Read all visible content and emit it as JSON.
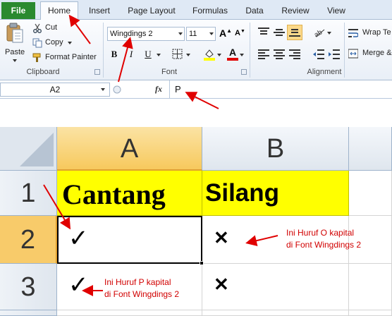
{
  "tabs": {
    "file": "File",
    "items": [
      "Home",
      "Insert",
      "Page Layout",
      "Formulas",
      "Data",
      "Review",
      "View"
    ]
  },
  "clipboard": {
    "paste": "Paste",
    "cut": "Cut",
    "copy": "Copy",
    "format_painter": "Format Painter",
    "label": "Clipboard"
  },
  "font": {
    "name": "Wingdings 2",
    "size": "11",
    "grow": "A",
    "shrink": "A",
    "bold": "B",
    "italic": "I",
    "underline": "U",
    "font_color_glyph": "A",
    "label": "Font"
  },
  "alignment": {
    "wrap_text": "Wrap Te",
    "merge": "Merge &",
    "label": "Alignment"
  },
  "formula_bar": {
    "name_box": "A2",
    "fx": "fx",
    "content": "P"
  },
  "grid": {
    "columns": [
      "A",
      "B"
    ],
    "rows": [
      "1",
      "2",
      "3"
    ],
    "a1": "Cantang",
    "b1": "Silang",
    "a2_mark": "✓",
    "b2_mark": "✕",
    "a3_mark": "✓",
    "b3_mark": "✕"
  },
  "notes": {
    "o_line1": "Ini Huruf O kapital",
    "o_line2": "di Font Wingdings 2",
    "p_line1": "Ini Huruf P kapital",
    "p_line2": "di Font Wingdings 2"
  },
  "colors": {
    "header_yellow": "#ffff00",
    "selection_orange": "#f8cb6a",
    "annotation_red": "#e00000"
  }
}
